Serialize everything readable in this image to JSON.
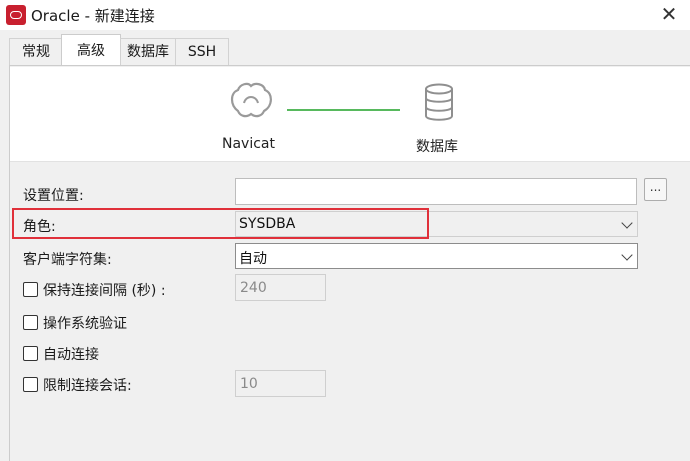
{
  "window": {
    "title": "Oracle - 新建连接",
    "close_glyph": "✕",
    "icon": "oracle-app-icon"
  },
  "tabs": [
    {
      "label": "常规",
      "active": false
    },
    {
      "label": "高级",
      "active": true
    },
    {
      "label": "数据库",
      "active": false
    },
    {
      "label": "SSH",
      "active": false
    }
  ],
  "banner": {
    "left_caption": "Navicat",
    "right_caption": "数据库",
    "left_icon": "navicat-seal-icon",
    "right_icon": "database-icon",
    "connector_color": "#57b95d"
  },
  "form": {
    "location": {
      "label": "设置位置:",
      "value": "",
      "browse_label": "..."
    },
    "role": {
      "label": "角色:",
      "value": "SYSDBA",
      "highlight_color": "#e0303a"
    },
    "charset": {
      "label": "客户端字符集:",
      "value": "自动"
    },
    "keepalive": {
      "label": "保持连接间隔 (秒) :",
      "checked": false,
      "value": "240"
    },
    "os_auth": {
      "label": "操作系统验证",
      "checked": false
    },
    "auto_connect": {
      "label": "自动连接",
      "checked": false
    },
    "limit_sessions": {
      "label": "限制连接会话:",
      "checked": false,
      "value": "10"
    }
  }
}
